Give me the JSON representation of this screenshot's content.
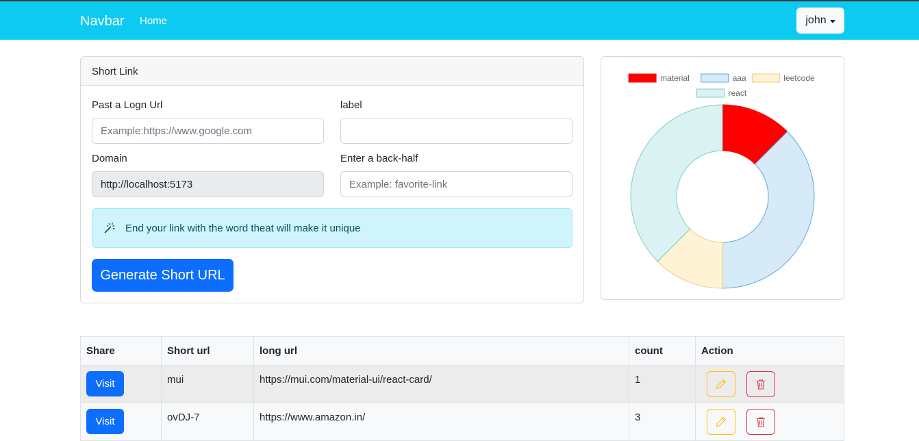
{
  "navbar": {
    "brand": "Navbar",
    "home": "Home",
    "user": "john"
  },
  "form": {
    "header": "Short Link",
    "long_url_label": "Past a Logn Url",
    "long_url_placeholder": "Example:https://www.google.com",
    "label_label": "label",
    "label_value": "",
    "domain_label": "Domain",
    "domain_value": "http://localhost:5173",
    "backhalf_label": "Enter a back-half",
    "backhalf_placeholder": "Example: favorite-link",
    "alert_text": "End your link with the word theat will make it unique",
    "alert_icon": "magic-wand-icon",
    "generate_label": "Generate Short URL"
  },
  "chart_data": {
    "type": "doughnut",
    "categories": [
      "material",
      "aaa",
      "leetcode",
      "react"
    ],
    "values": [
      1,
      3,
      1,
      3
    ],
    "colors": [
      "#ff0000",
      "#d6eaf8",
      "#fff3d6",
      "#daf2f2"
    ],
    "borders": [
      "#ff0000",
      "#5da9dd",
      "#f5c87a",
      "#7fcdc4"
    ],
    "legend_position": "top"
  },
  "table": {
    "headers": [
      "Share",
      "Short url",
      "long url",
      "count",
      "Action"
    ],
    "rows": [
      {
        "share": "Visit",
        "short": "mui",
        "long": "https://mui.com/material-ui/react-card/",
        "count": "1"
      },
      {
        "share": "Visit",
        "short": "ovDJ-7",
        "long": "https://www.amazon.in/",
        "count": "3"
      }
    ],
    "edit_icon": "pencil-icon",
    "delete_icon": "trash-icon"
  },
  "colors": {
    "primary": "#0d6efd",
    "navbar": "#0dcaf0",
    "warning": "#ffc107",
    "danger": "#dc3545"
  }
}
